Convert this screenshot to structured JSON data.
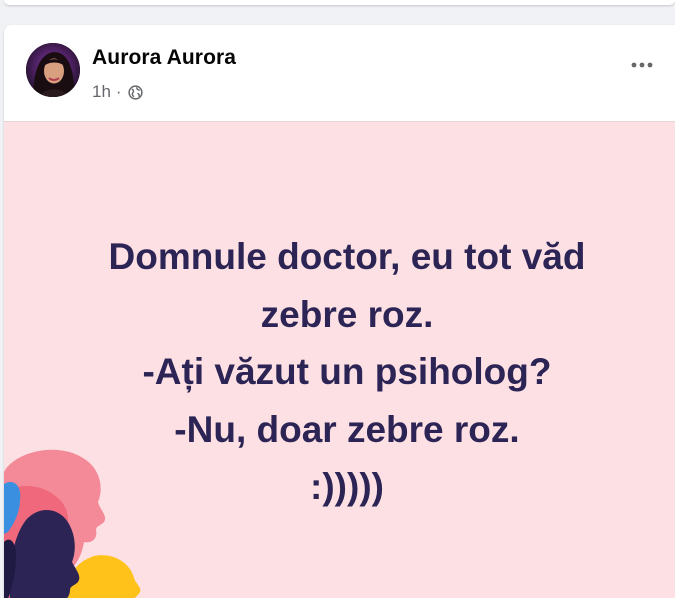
{
  "post": {
    "author_name": "Aurora Aurora",
    "timestamp": "1h",
    "separator": "·",
    "audience_icon": "globe-icon",
    "more_icon": "more-horizontal-icon",
    "image_text": {
      "lines": [
        "Domnule doctor, eu tot văd",
        "zebre roz.",
        "-Ați văzut un psiholog?",
        "-Nu, doar zebre roz.",
        ":)))))"
      ]
    }
  },
  "colors": {
    "image_background": "#fde0e4",
    "quote_text": "#2b2454",
    "author_text": "#050505",
    "meta_text": "#65676b"
  }
}
